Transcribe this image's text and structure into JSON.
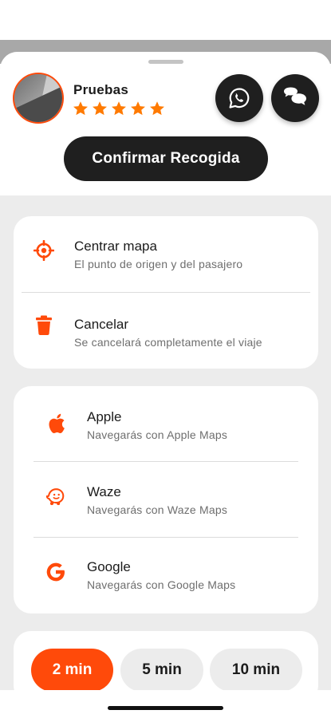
{
  "colors": {
    "accent": "#ff4a0a",
    "dark": "#1f1f1f",
    "background": "#ececec"
  },
  "driver": {
    "name": "Pruebas",
    "rating_stars": 5,
    "avatar_icon": "user-photo"
  },
  "header": {
    "whatsapp_icon": "whatsapp-icon",
    "chat_icon": "chat-bubbles-icon",
    "confirm_label": "Confirmar Recogida"
  },
  "actions": [
    {
      "icon": "crosshair-icon",
      "title": "Centrar mapa",
      "subtitle": "El punto de origen y del pasajero"
    },
    {
      "icon": "trash-icon",
      "title": "Cancelar",
      "subtitle": "Se cancelará completamente el viaje"
    }
  ],
  "navigation": [
    {
      "icon": "apple-icon",
      "title": "Apple",
      "subtitle": "Navegarás con Apple Maps"
    },
    {
      "icon": "waze-icon",
      "title": "Waze",
      "subtitle": "Navegarás con Waze Maps"
    },
    {
      "icon": "google-icon",
      "title": "Google",
      "subtitle": "Navegarás con Google Maps"
    }
  ],
  "time_options": [
    {
      "label": "2 min",
      "selected": true
    },
    {
      "label": "5 min",
      "selected": false
    },
    {
      "label": "10 min",
      "selected": false
    }
  ]
}
